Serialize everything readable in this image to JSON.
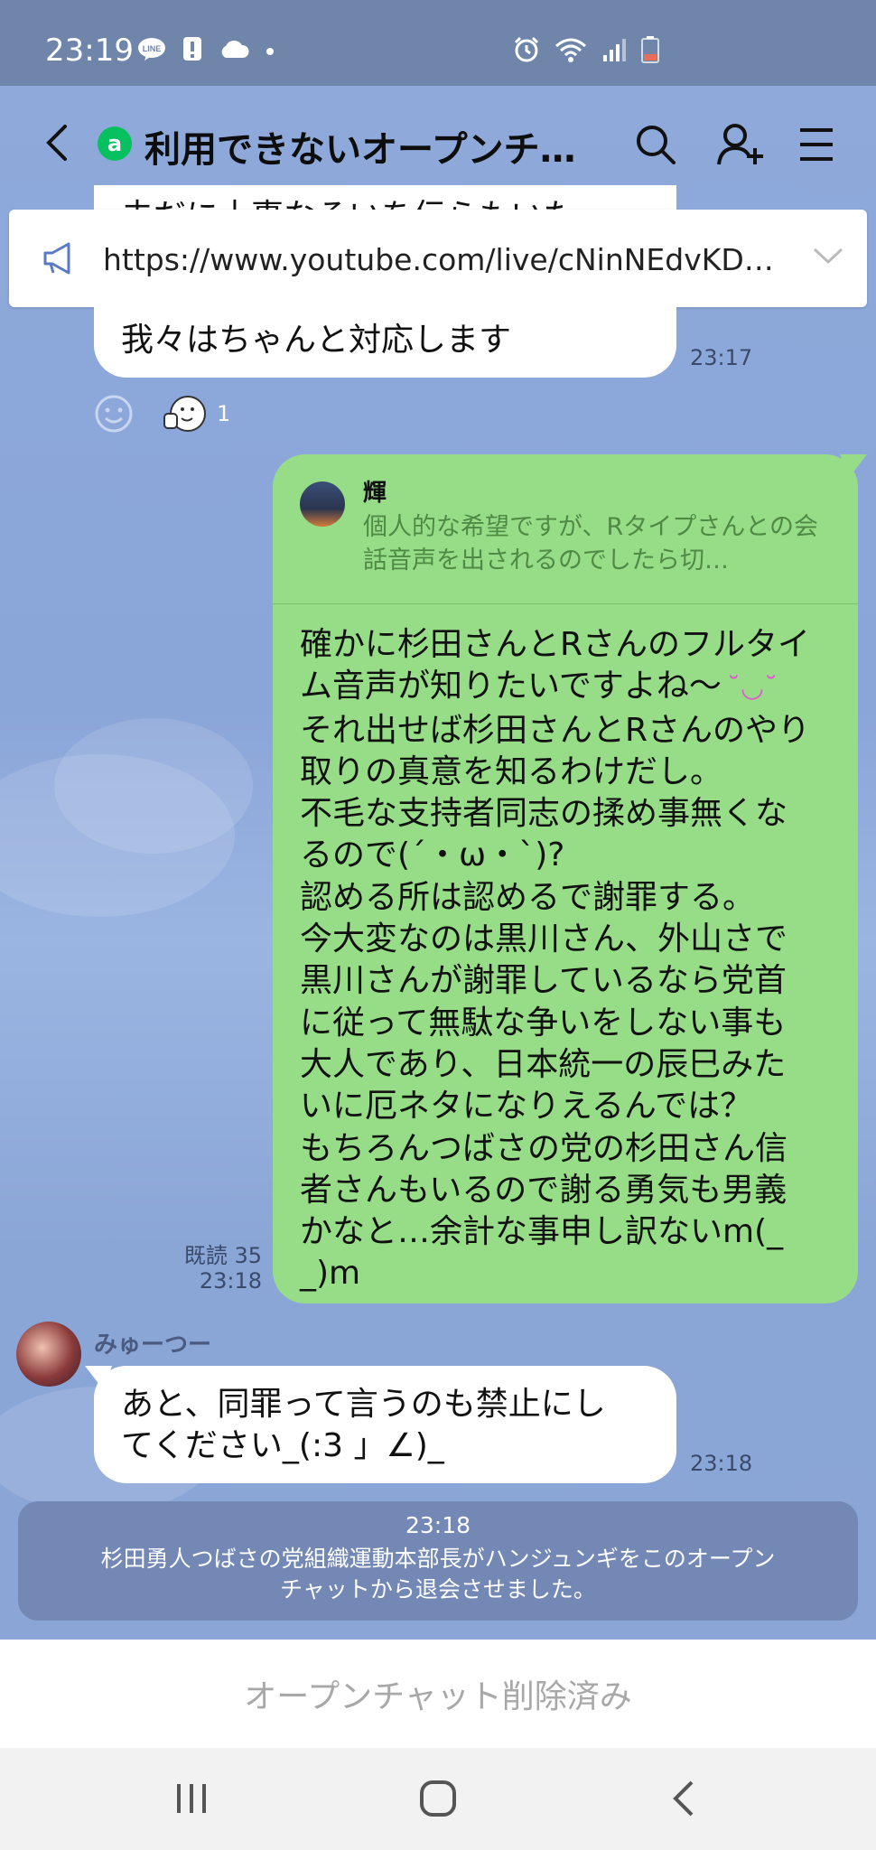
{
  "status_bar": {
    "time": "23:19",
    "left_icons": [
      "line-notification-icon",
      "alert-icon",
      "cloud-icon",
      "dot-icon"
    ],
    "right_icons": [
      "alarm-icon",
      "wifi-icon",
      "signal-icon",
      "battery-low-icon"
    ]
  },
  "header": {
    "badge": "a",
    "title": "利用できないオープンチ…",
    "icons": [
      "back-icon",
      "search-icon",
      "add-friend-icon",
      "menu-icon"
    ]
  },
  "announcement": {
    "icon": "megaphone-icon",
    "text": "https://www.youtube.com/live/cNinNEdvKD…"
  },
  "messages": {
    "partial_top_text": "未だに土事なそいを伝らもいた",
    "msg1": {
      "text": "我々はちゃんと対応します",
      "time": "23:17",
      "reaction_count": "1"
    },
    "msg2": {
      "reply_to_name": "輝",
      "reply_to_text": "個人的な希望ですが、Rタイプさんとの会話音声を出されるのでしたら切…",
      "lines": [
        "確かに杉田さんとRさんのフルタイ",
        "ム音声が知りたいですよね〜",
        "それ出せば杉田さんとRさんのやり",
        "取りの真意を知るわけだし。",
        "不毛な支持者同志の揉め事無くな",
        "るので(´・ω・`)?",
        "認める所は認めるで謝罪する。",
        "今大変なのは黒川さん、外山さで",
        "黒川さんが謝罪しているなら党首",
        "に従って無駄な争いをしない事も",
        "大人であり、日本統一の辰巳みた",
        "いに厄ネタになりえるんでは？",
        "もちろんつばさの党の杉田さん信",
        "者さんもいるので謝る勇気も男義",
        "かなと…余計な事申し訳ないm(_",
        "_)m"
      ],
      "emoji": "˘◡˘",
      "read_label": "既読 35",
      "time": "23:18"
    },
    "msg3": {
      "sender": "みゅーつー",
      "lines": [
        "あと、同罪って言うのも禁止にし",
        "てください_(:3 」∠)_"
      ],
      "time": "23:18"
    },
    "system": {
      "time": "23:18",
      "lines": [
        "杉田勇人つばさの党組織運動本部長がハンジュンギをこのオープン",
        "チャットから退会させました。"
      ]
    }
  },
  "bottom": {
    "label": "オープンチャット削除済み"
  },
  "nav": {
    "icons": [
      "recent-apps-icon",
      "home-icon",
      "back-nav-icon"
    ]
  },
  "colors": {
    "chat_bg": "#8aa6d6",
    "green_bubble": "#97dd88",
    "status_bar": "#6f85aa",
    "openchat_green": "#07c160"
  }
}
